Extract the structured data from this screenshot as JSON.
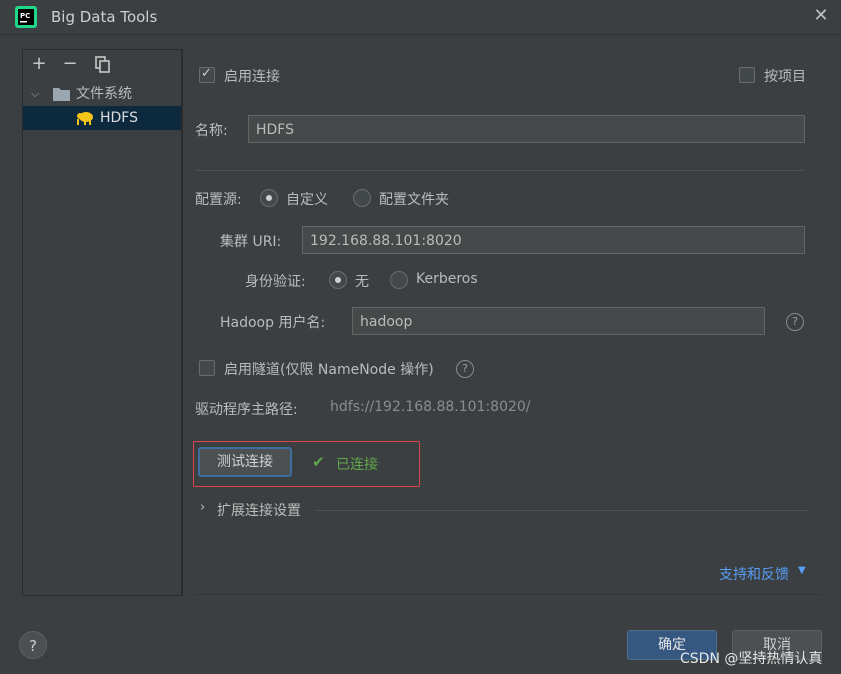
{
  "window": {
    "title": "Big Data Tools",
    "close_glyph": "✕"
  },
  "toolbar": {
    "add": "+",
    "remove": "−",
    "copy": "⧉"
  },
  "tree": {
    "folder_label": "文件系统",
    "item_label": "HDFS"
  },
  "form": {
    "enable_connection_label": "启用连接",
    "enable_connection_checked": true,
    "per_project_label": "按项目",
    "per_project_checked": false,
    "name_label": "名称:",
    "name_value": "HDFS",
    "config_source_label": "配置源:",
    "config_source_options": [
      "自定义",
      "配置文件夹"
    ],
    "config_source_selected": "自定义",
    "cluster_uri_label": "集群 URI:",
    "cluster_uri_value": "192.168.88.101:8020",
    "auth_label": "身份验证:",
    "auth_options": [
      "无",
      "Kerberos"
    ],
    "auth_selected": "无",
    "hadoop_user_label": "Hadoop 用户名:",
    "hadoop_user_value": "hadoop",
    "tunnel_label": "启用隧道(仅限 NameNode 操作)",
    "tunnel_checked": false,
    "driver_path_label": "驱动程序主路径:",
    "driver_path_value": "hdfs://192.168.88.101:8020/",
    "test_button": "测试连接",
    "connected_status": "已连接",
    "extended_settings": "扩展连接设置",
    "support_link": "支持和反馈"
  },
  "footer": {
    "help": "?",
    "ok": "确定",
    "cancel": "取消"
  },
  "watermark": "CSDN @坚持热情认真",
  "colors": {
    "background": "#3c3f41",
    "accent_blue": "#365880",
    "link": "#589df6",
    "success": "#5fa84b",
    "highlight_border": "#e0444b",
    "selection": "#0d293e"
  }
}
